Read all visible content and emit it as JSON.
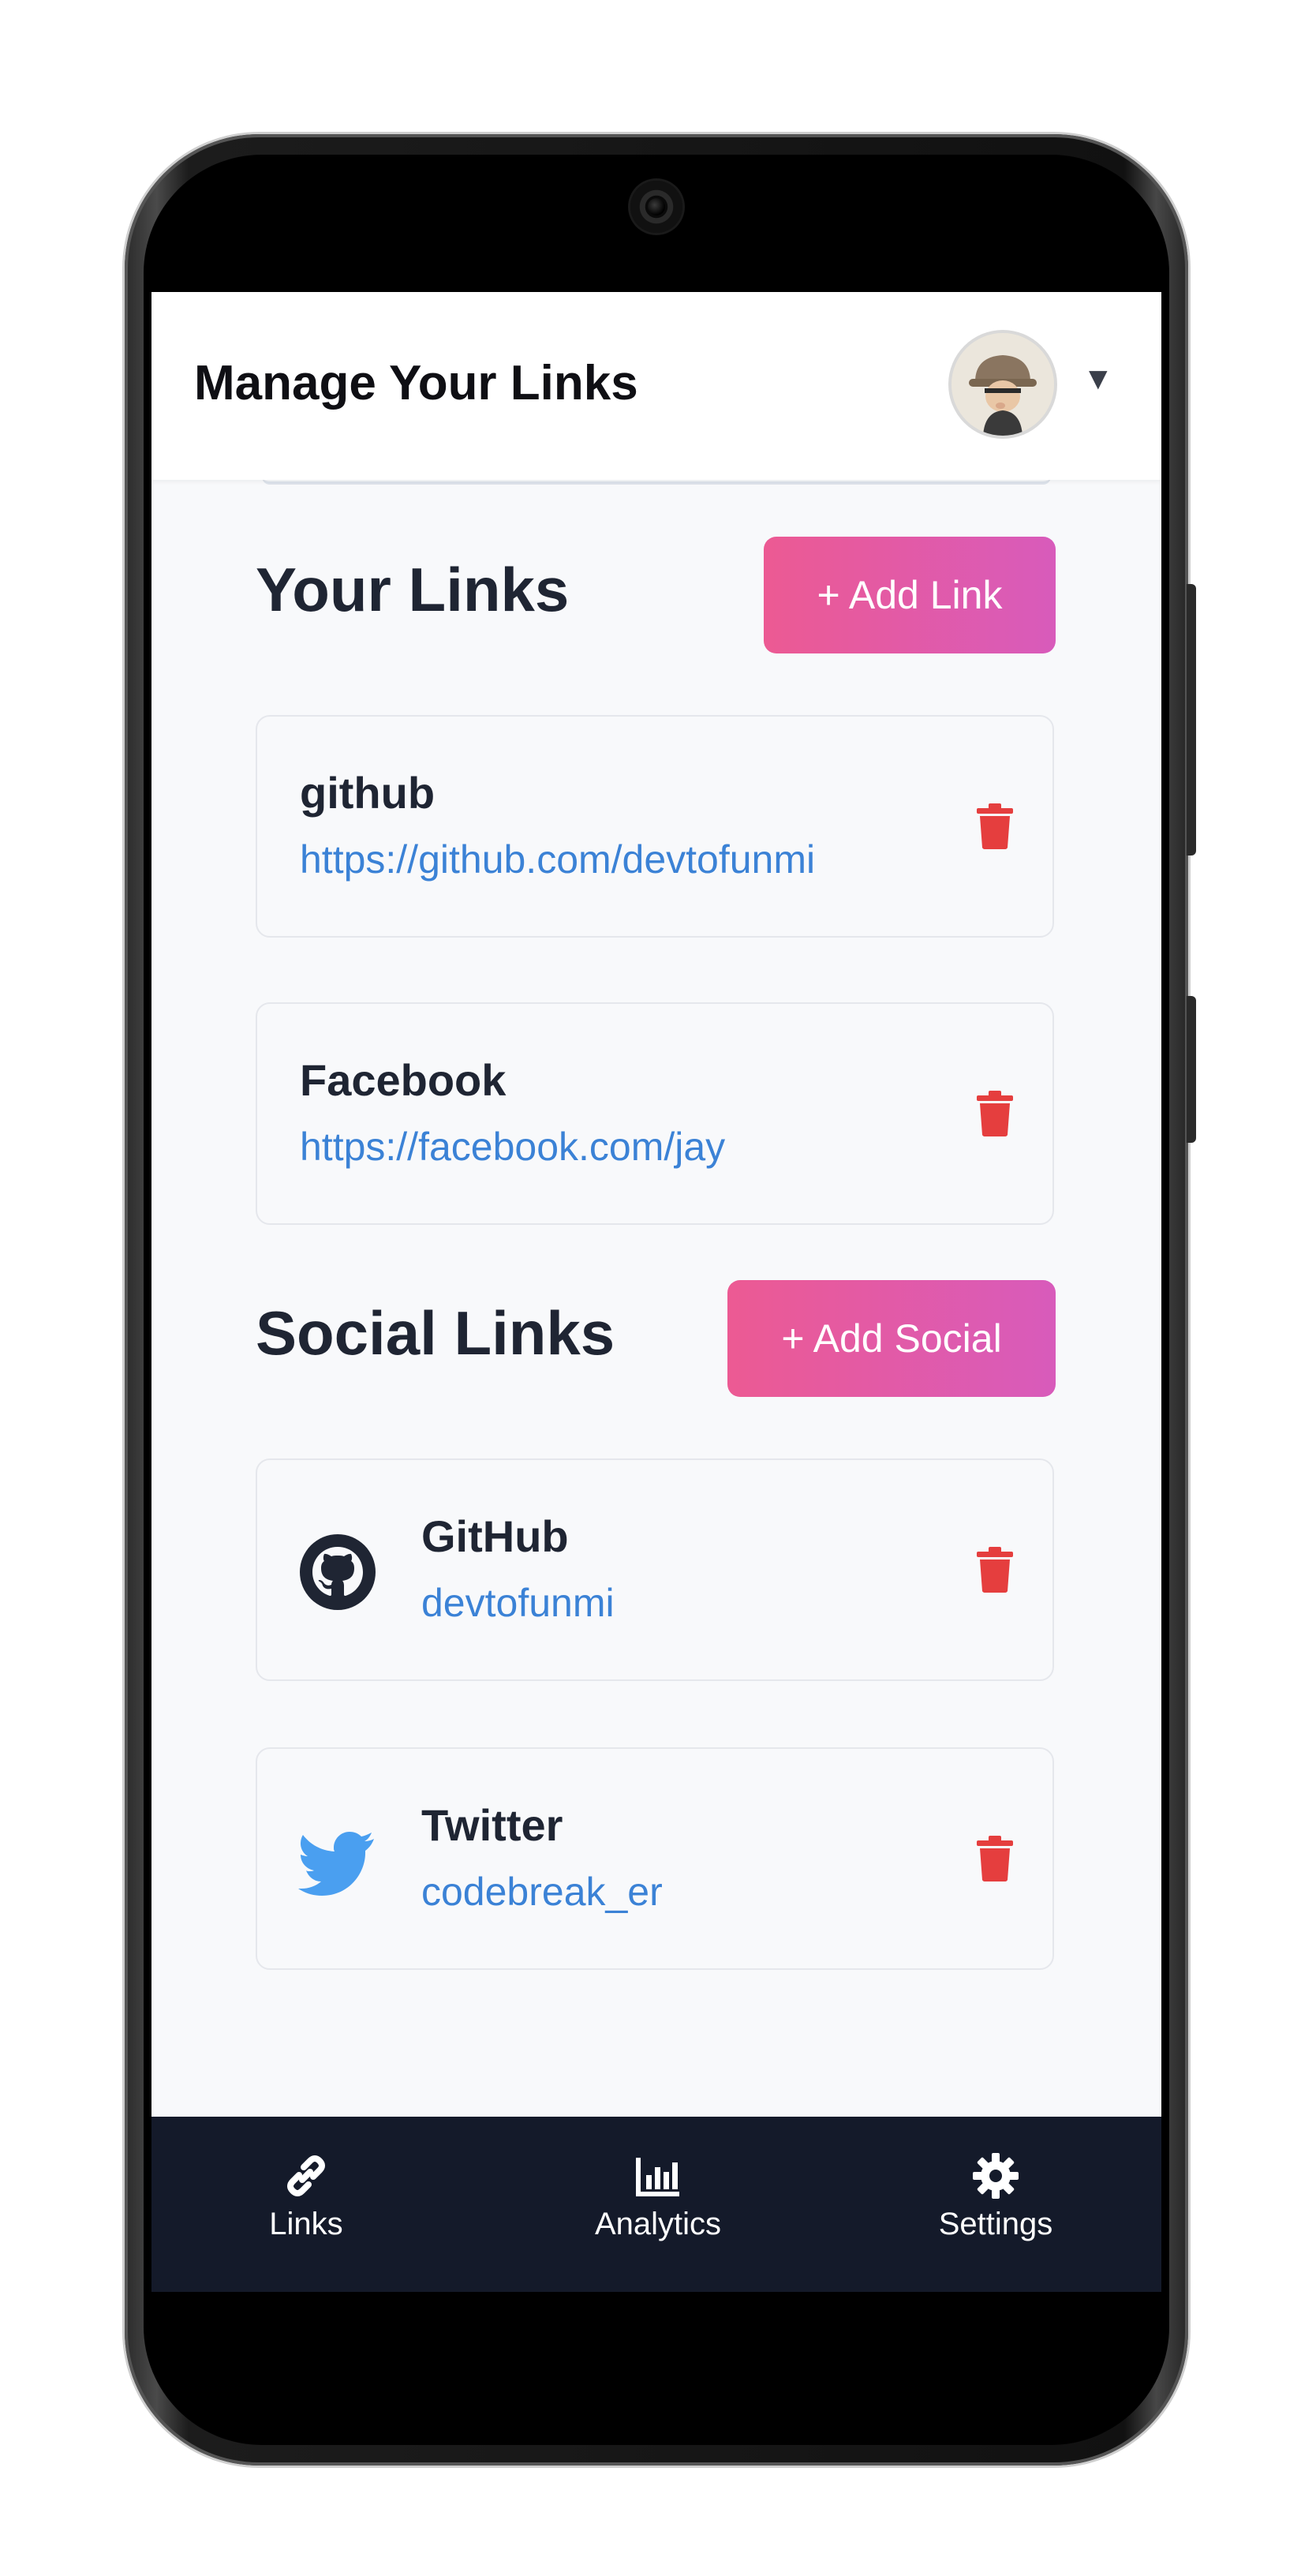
{
  "header": {
    "title": "Manage Your Links",
    "caret": "▼"
  },
  "links_section": {
    "title": "Your Links",
    "add_button": "+ Add Link",
    "items": [
      {
        "name": "github",
        "url": "https://github.com/devtofunmi"
      },
      {
        "name": "Facebook",
        "url": "https://facebook.com/jay"
      }
    ]
  },
  "social_section": {
    "title": "Social Links",
    "add_button": "+ Add Social",
    "items": [
      {
        "platform": "GitHub",
        "handle": "devtofunmi",
        "icon": "github-icon"
      },
      {
        "platform": "Twitter",
        "handle": "codebreak_er",
        "icon": "twitter-icon"
      }
    ]
  },
  "bottom_nav": {
    "items": [
      {
        "label": "Links",
        "icon": "link-icon"
      },
      {
        "label": "Analytics",
        "icon": "bar-chart-icon"
      },
      {
        "label": "Settings",
        "icon": "gear-icon"
      }
    ]
  },
  "colors": {
    "accent_gradient_start": "#ec5a93",
    "accent_gradient_end": "#d85bbb",
    "link_blue": "#3b82d6",
    "delete_red": "#e53e3e",
    "nav_background": "#141a2a",
    "twitter_blue": "#4a9ff0"
  }
}
